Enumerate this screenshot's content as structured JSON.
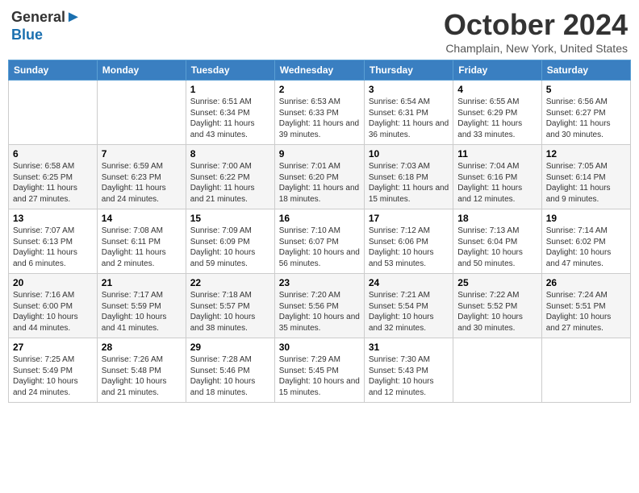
{
  "header": {
    "logo_general": "General",
    "logo_blue": "Blue",
    "month_title": "October 2024",
    "location": "Champlain, New York, United States"
  },
  "weekdays": [
    "Sunday",
    "Monday",
    "Tuesday",
    "Wednesday",
    "Thursday",
    "Friday",
    "Saturday"
  ],
  "weeks": [
    [
      null,
      null,
      {
        "day": "1",
        "sunrise": "6:51 AM",
        "sunset": "6:34 PM",
        "daylight": "11 hours and 43 minutes."
      },
      {
        "day": "2",
        "sunrise": "6:53 AM",
        "sunset": "6:33 PM",
        "daylight": "11 hours and 39 minutes."
      },
      {
        "day": "3",
        "sunrise": "6:54 AM",
        "sunset": "6:31 PM",
        "daylight": "11 hours and 36 minutes."
      },
      {
        "day": "4",
        "sunrise": "6:55 AM",
        "sunset": "6:29 PM",
        "daylight": "11 hours and 33 minutes."
      },
      {
        "day": "5",
        "sunrise": "6:56 AM",
        "sunset": "6:27 PM",
        "daylight": "11 hours and 30 minutes."
      }
    ],
    [
      {
        "day": "6",
        "sunrise": "6:58 AM",
        "sunset": "6:25 PM",
        "daylight": "11 hours and 27 minutes."
      },
      {
        "day": "7",
        "sunrise": "6:59 AM",
        "sunset": "6:23 PM",
        "daylight": "11 hours and 24 minutes."
      },
      {
        "day": "8",
        "sunrise": "7:00 AM",
        "sunset": "6:22 PM",
        "daylight": "11 hours and 21 minutes."
      },
      {
        "day": "9",
        "sunrise": "7:01 AM",
        "sunset": "6:20 PM",
        "daylight": "11 hours and 18 minutes."
      },
      {
        "day": "10",
        "sunrise": "7:03 AM",
        "sunset": "6:18 PM",
        "daylight": "11 hours and 15 minutes."
      },
      {
        "day": "11",
        "sunrise": "7:04 AM",
        "sunset": "6:16 PM",
        "daylight": "11 hours and 12 minutes."
      },
      {
        "day": "12",
        "sunrise": "7:05 AM",
        "sunset": "6:14 PM",
        "daylight": "11 hours and 9 minutes."
      }
    ],
    [
      {
        "day": "13",
        "sunrise": "7:07 AM",
        "sunset": "6:13 PM",
        "daylight": "11 hours and 6 minutes."
      },
      {
        "day": "14",
        "sunrise": "7:08 AM",
        "sunset": "6:11 PM",
        "daylight": "11 hours and 2 minutes."
      },
      {
        "day": "15",
        "sunrise": "7:09 AM",
        "sunset": "6:09 PM",
        "daylight": "10 hours and 59 minutes."
      },
      {
        "day": "16",
        "sunrise": "7:10 AM",
        "sunset": "6:07 PM",
        "daylight": "10 hours and 56 minutes."
      },
      {
        "day": "17",
        "sunrise": "7:12 AM",
        "sunset": "6:06 PM",
        "daylight": "10 hours and 53 minutes."
      },
      {
        "day": "18",
        "sunrise": "7:13 AM",
        "sunset": "6:04 PM",
        "daylight": "10 hours and 50 minutes."
      },
      {
        "day": "19",
        "sunrise": "7:14 AM",
        "sunset": "6:02 PM",
        "daylight": "10 hours and 47 minutes."
      }
    ],
    [
      {
        "day": "20",
        "sunrise": "7:16 AM",
        "sunset": "6:00 PM",
        "daylight": "10 hours and 44 minutes."
      },
      {
        "day": "21",
        "sunrise": "7:17 AM",
        "sunset": "5:59 PM",
        "daylight": "10 hours and 41 minutes."
      },
      {
        "day": "22",
        "sunrise": "7:18 AM",
        "sunset": "5:57 PM",
        "daylight": "10 hours and 38 minutes."
      },
      {
        "day": "23",
        "sunrise": "7:20 AM",
        "sunset": "5:56 PM",
        "daylight": "10 hours and 35 minutes."
      },
      {
        "day": "24",
        "sunrise": "7:21 AM",
        "sunset": "5:54 PM",
        "daylight": "10 hours and 32 minutes."
      },
      {
        "day": "25",
        "sunrise": "7:22 AM",
        "sunset": "5:52 PM",
        "daylight": "10 hours and 30 minutes."
      },
      {
        "day": "26",
        "sunrise": "7:24 AM",
        "sunset": "5:51 PM",
        "daylight": "10 hours and 27 minutes."
      }
    ],
    [
      {
        "day": "27",
        "sunrise": "7:25 AM",
        "sunset": "5:49 PM",
        "daylight": "10 hours and 24 minutes."
      },
      {
        "day": "28",
        "sunrise": "7:26 AM",
        "sunset": "5:48 PM",
        "daylight": "10 hours and 21 minutes."
      },
      {
        "day": "29",
        "sunrise": "7:28 AM",
        "sunset": "5:46 PM",
        "daylight": "10 hours and 18 minutes."
      },
      {
        "day": "30",
        "sunrise": "7:29 AM",
        "sunset": "5:45 PM",
        "daylight": "10 hours and 15 minutes."
      },
      {
        "day": "31",
        "sunrise": "7:30 AM",
        "sunset": "5:43 PM",
        "daylight": "10 hours and 12 minutes."
      },
      null,
      null
    ]
  ],
  "labels": {
    "sunrise_prefix": "Sunrise: ",
    "sunset_prefix": "Sunset: ",
    "daylight_prefix": "Daylight: "
  }
}
